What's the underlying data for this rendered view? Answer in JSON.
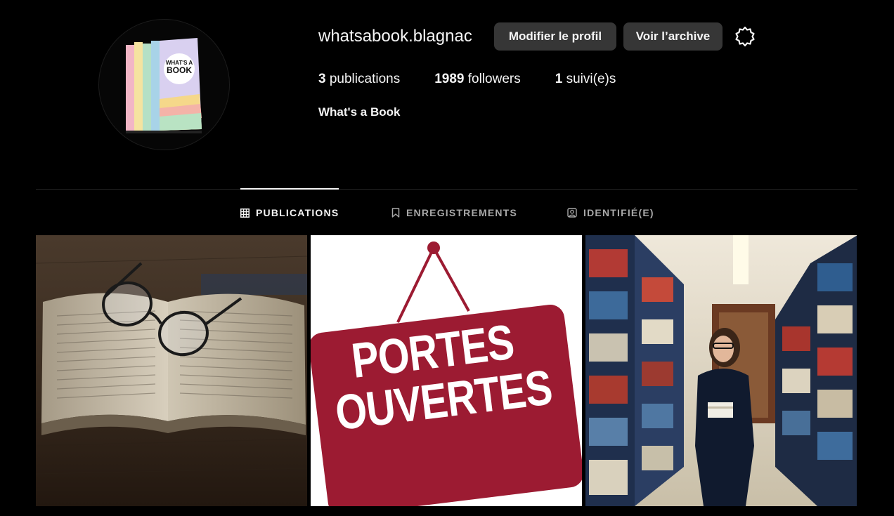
{
  "profile": {
    "username": "whatsabook.blagnac",
    "full_name": "What's a Book",
    "avatar_icon": "books-logo-icon",
    "avatar_logo_text": "WHAT'S A BOOK"
  },
  "actions": {
    "edit_profile": "Modifier le profil",
    "view_archive": "Voir l’archive",
    "settings_icon": "gear-icon"
  },
  "stats": {
    "posts_count": "3",
    "posts_label": "publications",
    "followers_count": "1989",
    "followers_label": "followers",
    "following_count": "1",
    "following_label": "suivi(e)s"
  },
  "tabs": [
    {
      "label": "PUBLICATIONS",
      "icon": "grid-icon",
      "active": true
    },
    {
      "label": "ENREGISTREMENTS",
      "icon": "bookmark-icon",
      "active": false
    },
    {
      "label": "IDENTIFIÉ(E)",
      "icon": "tagged-user-icon",
      "active": false
    }
  ],
  "posts": [
    {
      "subject": "open-book-with-glasses"
    },
    {
      "subject": "portes-ouvertes-sign",
      "sign_line1": "PORTES",
      "sign_line2": "OUVERTES"
    },
    {
      "subject": "woman-in-library-aisle"
    }
  ],
  "colors": {
    "background": "#000000",
    "button_bg": "#363636",
    "text_primary": "#f5f5f5",
    "text_secondary": "#a8a8a8",
    "sign_red": "#9c1b32"
  }
}
